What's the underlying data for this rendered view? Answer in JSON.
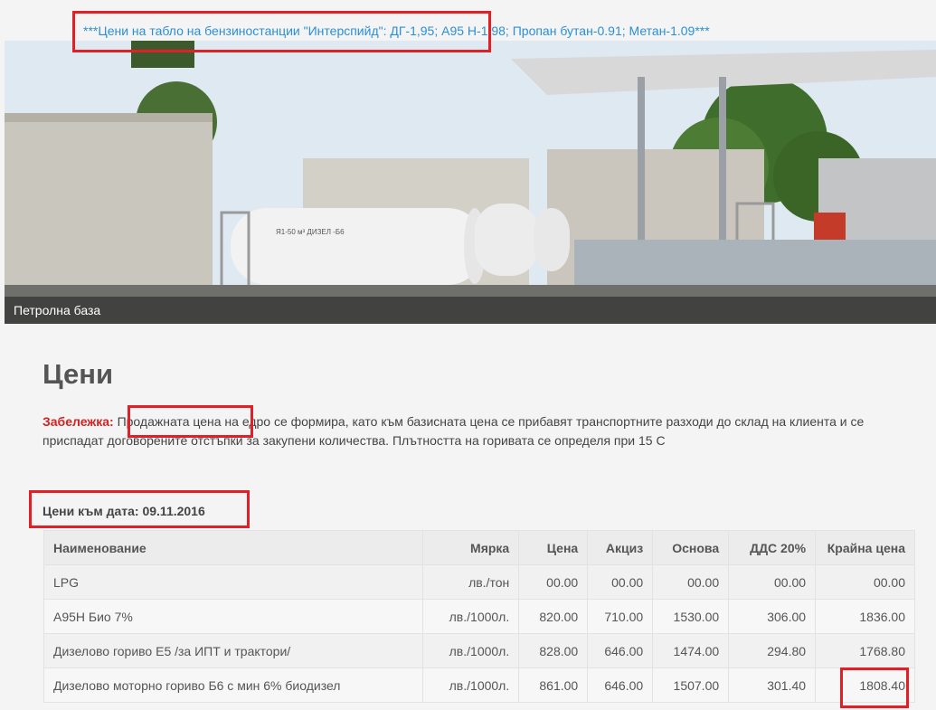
{
  "ticker": {
    "text": "***Цени на табло на бензиностанции \"Интерспийд\": ДГ-1,95; А95 Н-1.98; Пропан бутан-0.91; Метан-1.09***"
  },
  "hero": {
    "caption": "Петролна база",
    "tank_label": "Я1-50 м³ ДИЗЕЛ -Б6"
  },
  "page": {
    "title": "Цени"
  },
  "note": {
    "label": "Забележка:",
    "text": "Продажната цена на едро се формира, като към базисната цена се прибавят транспортните разходи до склад на клиента и се приспадат договорените отстъпки  за закупени количества. Плътността на горивата се определя при  15 С"
  },
  "date": {
    "label": "Цени към дата: 09.11.2016"
  },
  "table": {
    "headers": {
      "name": "Наименование",
      "unit": "Мярка",
      "price": "Цена",
      "excise": "Акциз",
      "base": "Основа",
      "vat": "ДДС 20%",
      "final": "Крайна цена"
    },
    "rows": [
      {
        "name": "LPG",
        "unit": "лв./тон",
        "price": "00.00",
        "excise": "00.00",
        "base": "00.00",
        "vat": "00.00",
        "final": "00.00"
      },
      {
        "name": "А95Н Био 7%",
        "unit": "лв./1000л.",
        "price": "820.00",
        "excise": "710.00",
        "base": "1530.00",
        "vat": "306.00",
        "final": "1836.00"
      },
      {
        "name": "Дизелово гориво  Е5 /за ИПТ и трактори/",
        "unit": "лв./1000л.",
        "price": "828.00",
        "excise": "646.00",
        "base": "1474.00",
        "vat": "294.80",
        "final": "1768.80"
      },
      {
        "name": "Дизелово моторно гориво Б6 с мин 6% биодизел",
        "unit": "лв./1000л.",
        "price": "861.00",
        "excise": "646.00",
        "base": "1507.00",
        "vat": "301.40",
        "final": "1808.40"
      }
    ]
  },
  "colors": {
    "link": "#2a8fd6",
    "note_label": "#d42222",
    "highlight_box": "#e01f27"
  }
}
